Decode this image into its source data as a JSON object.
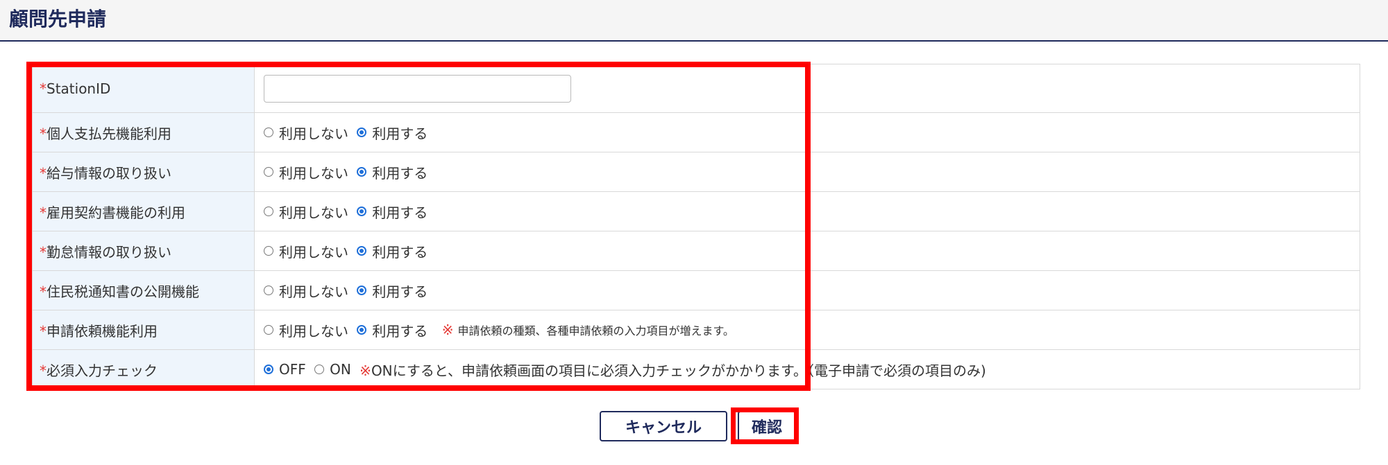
{
  "header": {
    "title": "顧問先申請"
  },
  "form": {
    "required_mark": "*",
    "station_id": {
      "label": "StationID",
      "value": ""
    },
    "rows": [
      {
        "label": "個人支払先機能利用",
        "options": [
          "利用しない",
          "利用する"
        ],
        "selected": 1,
        "note": ""
      },
      {
        "label": "給与情報の取り扱い",
        "options": [
          "利用しない",
          "利用する"
        ],
        "selected": 1,
        "note": ""
      },
      {
        "label": "雇用契約書機能の利用",
        "options": [
          "利用しない",
          "利用する"
        ],
        "selected": 1,
        "note": ""
      },
      {
        "label": "勤怠情報の取り扱い",
        "options": [
          "利用しない",
          "利用する"
        ],
        "selected": 1,
        "note": ""
      },
      {
        "label": "住民税通知書の公開機能",
        "options": [
          "利用しない",
          "利用する"
        ],
        "selected": 1,
        "note": ""
      },
      {
        "label": "申請依頼機能利用",
        "options": [
          "利用しない",
          "利用する"
        ],
        "selected": 1,
        "note_mark": "※",
        "note": "申請依頼の種類、各種申請依頼の入力項目が増えます。"
      },
      {
        "label": "必須入力チェック",
        "options": [
          "OFF",
          "ON"
        ],
        "selected": 0,
        "note_mark": "※",
        "note": "ONにすると、申請依頼画面の項目に必須入力チェックがかかります。（電子申請で必須の項目のみ)"
      }
    ]
  },
  "buttons": {
    "cancel": "キャンセル",
    "confirm": "確認"
  },
  "colors": {
    "accent": "#1f2a5c",
    "required": "#e53935",
    "radio": "#1e6fd9",
    "highlight": "#ff0000",
    "label_bg": "#eef5fc"
  }
}
